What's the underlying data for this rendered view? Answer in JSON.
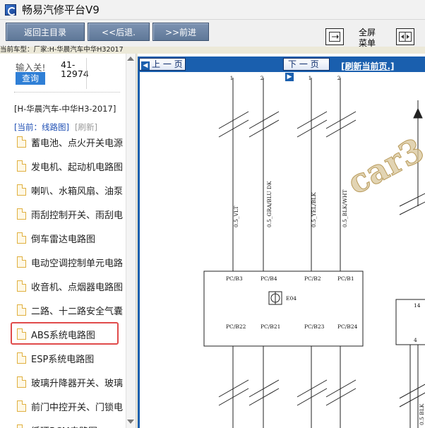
{
  "window": {
    "title": "畅易汽修平台V9"
  },
  "toolbar": {
    "home": "返回主目录",
    "back": "<<后退.",
    "forward": ">>前进",
    "fullscreen_line1": "全屏",
    "fullscreen_line2": "菜单"
  },
  "vehicle_bar": "当前车型：厂家:H-华晨汽车中华H32017",
  "sidebar": {
    "search_label": "输入关!",
    "search_value": "41-\n12974",
    "search_button": "查询",
    "car_model": "[H-华晨汽车-中华H3-2017]",
    "current": "[当前：线路图]",
    "refresh": "[刷新]",
    "items": [
      "蓄电池、点火开关电源",
      "发电机、起动机电路图",
      "喇叭、水箱风扇、油泵",
      "雨刮控制开关、雨刮电",
      "倒车雷达电路图",
      "电动空调控制单元电路",
      "收音机、点烟器电路图",
      "二路、十二路安全气囊",
      "ABS系统电路图",
      "ESP系统电路图",
      "玻璃升降器开关、玻璃",
      "前门中控开关、门锁电",
      "循环BCM电路图"
    ]
  },
  "viewer": {
    "prev_page": "上 一 页",
    "next_page": "下 一 页",
    "refresh_page": "[刷新当前页.]"
  },
  "diagram": {
    "watermark": "car3",
    "wire_labels": [
      "0.5_VLT",
      "0.5_GRA/BLU DK",
      "0.5_YEL/BLK",
      "0.5_BLK/WHT",
      "0.5 BLK"
    ],
    "pin_numbers_top": [
      "1",
      "2",
      "1",
      "2"
    ],
    "connector_top": [
      "PC/B3",
      "PC/B4",
      "PC/B2",
      "PC/B1"
    ],
    "connector_bottom": [
      "PC/B22",
      "PC/B21",
      "PC/B23",
      "PC/B24"
    ],
    "component": "E04",
    "right_box_top": "14",
    "right_box_bottom": "4"
  }
}
